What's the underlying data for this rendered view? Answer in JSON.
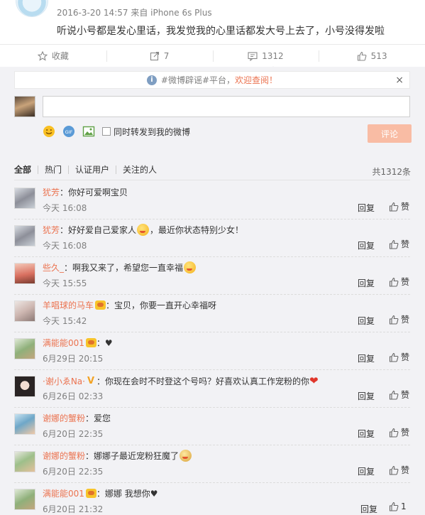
{
  "post": {
    "meta": "2016-3-20 14:57 来自 iPhone 6s Plus",
    "text": "听说小号都是发心里话，我发觉我的心里话都发大号上去了，小号没得发啦"
  },
  "actions": {
    "favorite": "收藏",
    "repost": "7",
    "comment": "1312",
    "like": "513"
  },
  "notice": {
    "prefix": "#微博辟谣#平台，",
    "link": "欢迎查阅！",
    "close": "×"
  },
  "composer": {
    "input_value": "",
    "repost_label": "同时转发到我的微博",
    "submit": "评论"
  },
  "tabs": [
    "全部",
    "热门",
    "认证用户",
    "关注的人"
  ],
  "total": "共1312条",
  "comments": [
    {
      "user": "犹芳",
      "text": "：你好可爱啊宝贝",
      "time": "今天 16:08",
      "reply": "回复",
      "like": "赞"
    },
    {
      "user": "犹芳",
      "text": "：好好爱自己爱家人",
      "text2": "，最近你状态特别少女！",
      "time": "今天 16:08",
      "reply": "回复",
      "like": "赞"
    },
    {
      "user": "些久_",
      "text": "：啊我又来了，希望您一直幸福",
      "time": "今天 15:55",
      "reply": "回复",
      "like": "赞"
    },
    {
      "user": "羊唱球的马车",
      "text": "：宝贝，你要一直开心幸福呀",
      "time": "今天 15:42",
      "reply": "回复",
      "like": "赞"
    },
    {
      "user": "满能能001",
      "text": "：",
      "heart": "♥",
      "time": "6月29日 20:15",
      "reply": "回复",
      "like": "赞"
    },
    {
      "user": "·谢小ゑNa·",
      "text": "：你现在会时不时登这个号吗？好喜欢认真工作宠粉的你",
      "heart": "❤",
      "time": "6月26日 02:33",
      "reply": "回复",
      "like": "赞"
    },
    {
      "user": "谢娜的蟹粉",
      "text": "：爱您",
      "time": "6月20日 22:35",
      "reply": "回复",
      "like": "赞"
    },
    {
      "user": "谢娜的蟹粉",
      "text": "：娜娜子最近宠粉狂魔了",
      "time": "6月20日 22:35",
      "reply": "回复",
      "like": "赞"
    },
    {
      "user": "满能能001",
      "text": "：娜娜 我想你",
      "heart": "♥",
      "time": "6月20日 21:32",
      "reply": "回复",
      "like": "1"
    }
  ],
  "colors": {
    "accent": "#eb7350",
    "panel": "#f2f2f5",
    "submit_bg": "#f9bca4"
  }
}
